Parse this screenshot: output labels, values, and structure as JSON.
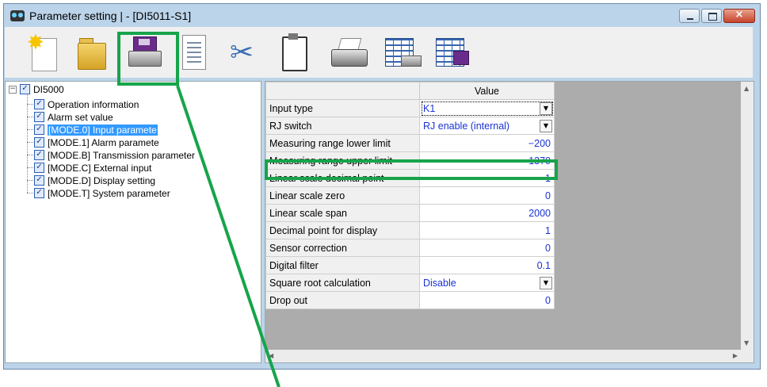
{
  "window": {
    "title": "Parameter setting |  - [DI5011-S1]",
    "controls": {
      "minimize": "minimize-icon",
      "maximize": "maximize-icon",
      "close": "close-icon"
    }
  },
  "toolbar": {
    "buttons": [
      {
        "name": "new",
        "icon": "new-file-icon"
      },
      {
        "name": "open",
        "icon": "folder-icon"
      },
      {
        "name": "save",
        "icon": "save-disk-icon"
      },
      {
        "name": "document",
        "icon": "document-icon"
      },
      {
        "name": "cut",
        "icon": "scissors-icon"
      },
      {
        "name": "paste",
        "icon": "clipboard-icon"
      },
      {
        "name": "print",
        "icon": "printer-icon"
      },
      {
        "name": "print-table",
        "icon": "table-print-icon"
      },
      {
        "name": "save-table",
        "icon": "table-save-icon"
      }
    ]
  },
  "tree": {
    "root": "DI5000",
    "items": [
      "Operation information",
      "Alarm set value",
      "[MODE.0] Input paramete",
      "[MODE.1] Alarm paramete",
      "[MODE.B] Transmission parameter",
      "[MODE.C] External input",
      "[MODE.D] Display setting",
      "[MODE.T] System parameter"
    ],
    "selected_index": 2
  },
  "grid": {
    "column_header": "Value",
    "rows": [
      {
        "name": "Input type",
        "value": "K1",
        "dropdown": true
      },
      {
        "name": "RJ switch",
        "value": "RJ enable (internal)",
        "dropdown": true
      },
      {
        "name": "Measuring range lower limit",
        "value": "−200"
      },
      {
        "name": "Measuring range upper limit",
        "value": "1370"
      },
      {
        "name": "Linear scale decimal point",
        "value": "1"
      },
      {
        "name": "Linear scale zero",
        "value": "0"
      },
      {
        "name": "Linear scale span",
        "value": "2000"
      },
      {
        "name": "Decimal point for display",
        "value": "1"
      },
      {
        "name": "Sensor correction",
        "value": "0"
      },
      {
        "name": "Digital filter",
        "value": "0.1"
      },
      {
        "name": "Square root calculation",
        "value": "Disable",
        "dropdown": true
      },
      {
        "name": "Drop out",
        "value": "0"
      }
    ]
  },
  "colors": {
    "highlight": "#17a44a",
    "value_text": "#1b32d6",
    "selection": "#3399ff"
  }
}
